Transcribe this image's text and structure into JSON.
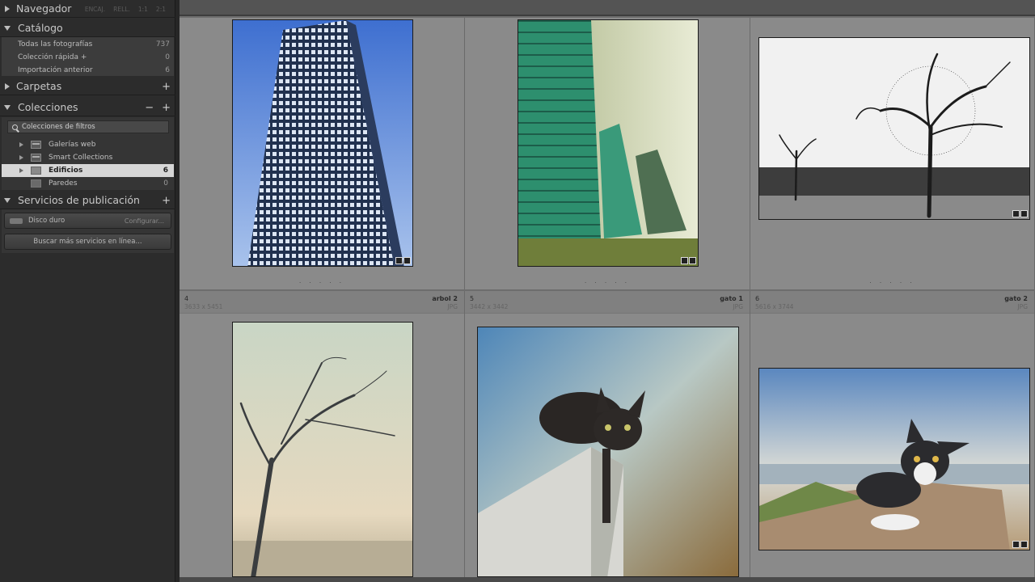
{
  "navigator": {
    "title": "Navegador",
    "zoom_options": [
      "ENCAJ.",
      "RELL.",
      "1:1",
      "2:1"
    ]
  },
  "catalog": {
    "title": "Catálogo",
    "items": [
      {
        "label": "Todas las fotografías",
        "count": "737"
      },
      {
        "label": "Colección rápida  +",
        "count": "0"
      },
      {
        "label": "Importación anterior",
        "count": "6"
      }
    ]
  },
  "folders": {
    "title": "Carpetas",
    "add": "+"
  },
  "collections": {
    "title": "Colecciones",
    "minus": "−",
    "add": "+",
    "filter_label": "Colecciones de filtros",
    "items": [
      {
        "label": "Galerías web",
        "count": ""
      },
      {
        "label": "Smart Collections",
        "count": ""
      },
      {
        "label": "Edificios",
        "count": "6"
      },
      {
        "label": "Paredes",
        "count": "0"
      }
    ]
  },
  "publish": {
    "title": "Servicios de publicación",
    "add": "+",
    "disk_label": "Disco duro",
    "disk_action": "Configurar...",
    "more_label": "Buscar más servicios en línea..."
  },
  "grid": {
    "top": [
      {
        "dots": ". . . . ."
      },
      {
        "dots": ". . . . ."
      },
      {
        "dots": ". . . . ."
      }
    ],
    "bottom": [
      {
        "index": "4",
        "dims": "3633 x 5451",
        "name": "arbol 2",
        "ext": "JPG"
      },
      {
        "index": "5",
        "dims": "3442 x 3442",
        "name": "gato 1",
        "ext": "JPG"
      },
      {
        "index": "6",
        "dims": "5616 x 3744",
        "name": "gato 2",
        "ext": "JPG"
      }
    ]
  }
}
